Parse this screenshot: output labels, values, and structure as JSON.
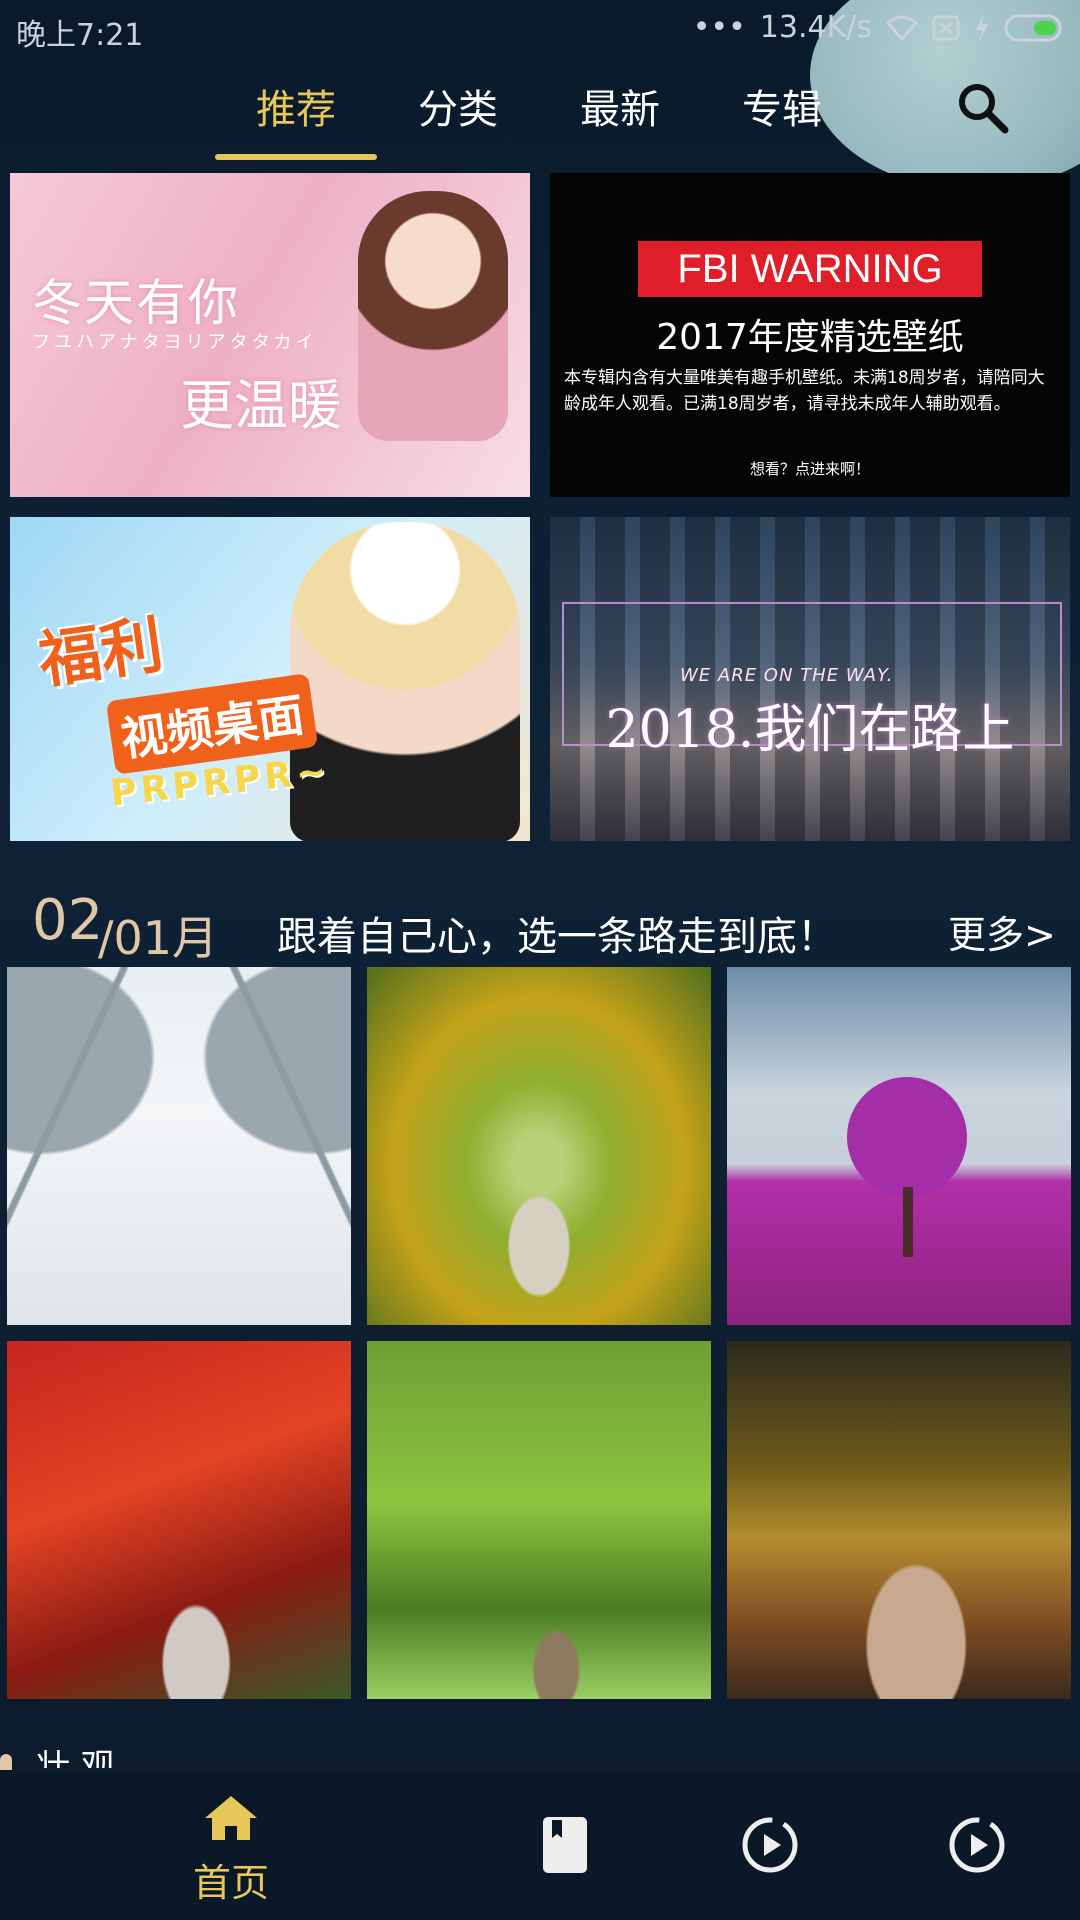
{
  "status_bar": {
    "time": "晚上7:21",
    "network_speed": "13.4K/s",
    "icons": [
      "more-dots-icon",
      "wifi-icon",
      "sim-icon",
      "charging-icon",
      "battery-icon"
    ]
  },
  "top_tabs": {
    "items": [
      {
        "label": "推荐",
        "active": true
      },
      {
        "label": "分类",
        "active": false
      },
      {
        "label": "最新",
        "active": false
      },
      {
        "label": "专辑",
        "active": false
      }
    ],
    "accent_color": "#e7c65a",
    "search_icon": "search-icon"
  },
  "banners": [
    {
      "line1": "冬天有你",
      "kana": "フユハアナタヨリアタタカイ",
      "line2": "更温暖"
    },
    {
      "warning": "FBI WARNING",
      "title": "2017年度精选壁纸",
      "body": "本专辑内含有大量唯美有趣手机壁纸。未满18周岁者，请陪同大龄成年人观看。已满18周岁者，请寻找未成年人辅助观看。",
      "footer": "想看？点进来啊！"
    },
    {
      "line1": "福利",
      "line2": "视频桌面",
      "line3": "PRPRPR~"
    },
    {
      "small": "WE ARE ON THE WAY.",
      "big": "2018.我们在路上"
    }
  ],
  "section": {
    "day": "02",
    "month": "/01月",
    "motto": "跟着自己心，选一条路走到底！",
    "more": "更多>"
  },
  "next_section_peek": "壮 观",
  "bottom_nav": {
    "items": [
      {
        "label": "首页",
        "icon": "home-icon",
        "active": true
      },
      {
        "label": "",
        "icon": "bookmark-icon",
        "active": false
      },
      {
        "label": "",
        "icon": "play-circle-icon",
        "active": false
      },
      {
        "label": "",
        "icon": "play-circle-icon",
        "active": false
      }
    ]
  }
}
